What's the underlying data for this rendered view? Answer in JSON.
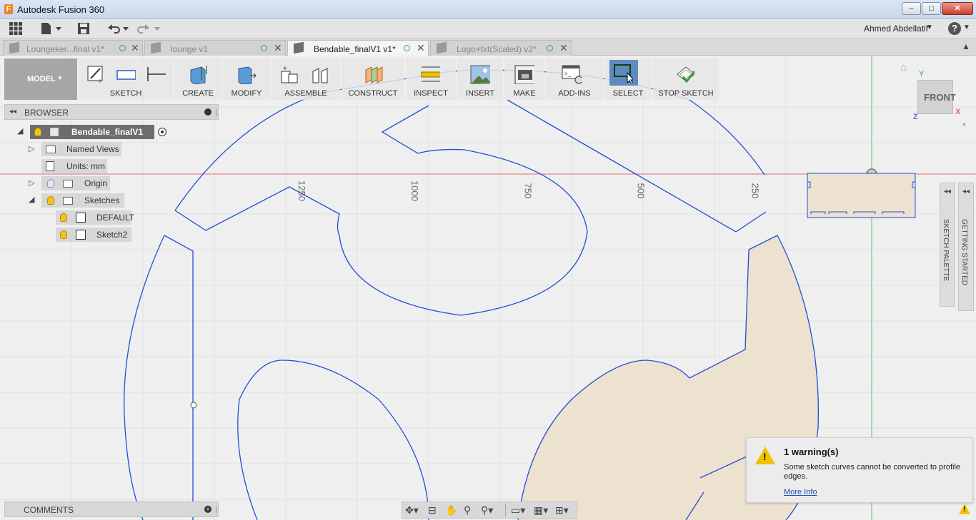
{
  "window": {
    "title": "Autodesk Fusion 360",
    "min": "–",
    "max": "□",
    "close": "✕"
  },
  "quick_access": {
    "user": "Ahmed Abdellatif",
    "help": "?"
  },
  "tabs": [
    {
      "label": "Loungeker...final v1*",
      "active": false
    },
    {
      "label": "lounge v1",
      "active": false
    },
    {
      "label": "Bendable_finalV1 v1*",
      "active": true
    },
    {
      "label": "Logo+txt(Scaled) v2*",
      "active": false
    }
  ],
  "toolbar": {
    "workspace": "MODEL",
    "groups": [
      {
        "label": "SKETCH"
      },
      {
        "label": "CREATE"
      },
      {
        "label": "MODIFY"
      },
      {
        "label": "ASSEMBLE"
      },
      {
        "label": "CONSTRUCT"
      },
      {
        "label": "INSPECT"
      },
      {
        "label": "INSERT"
      },
      {
        "label": "MAKE"
      },
      {
        "label": "ADD-INS"
      },
      {
        "label": "SELECT"
      },
      {
        "label": "STOP SKETCH"
      }
    ]
  },
  "browser": {
    "title": "BROWSER",
    "root": "Bendable_finalV1 v1",
    "named_views": "Named Views",
    "units": "Units: mm",
    "origin": "Origin",
    "sketches": "Sketches",
    "sketch_items": [
      "DEFAULT",
      "Sketch2"
    ]
  },
  "comments": {
    "label": "COMMENTS"
  },
  "viewcube": {
    "face": "FRONT",
    "axes": {
      "y": "Y",
      "x": "X",
      "z": "Z"
    }
  },
  "palettes": {
    "sketch_palette": "SKETCH PALETTE",
    "getting_started": "GETTING STARTED"
  },
  "ruler_labels": [
    "1250",
    "1000",
    "750",
    "500",
    "250"
  ],
  "warning": {
    "title": "1 warning(s)",
    "body": "Some sketch curves cannot be converted to profile edges.",
    "link": "More Info"
  },
  "colors": {
    "sketch_line": "#1f4fd6",
    "profile_fill": "#ede1cf",
    "axis_red": "#e06b6b",
    "axis_green": "#5cc46a"
  }
}
